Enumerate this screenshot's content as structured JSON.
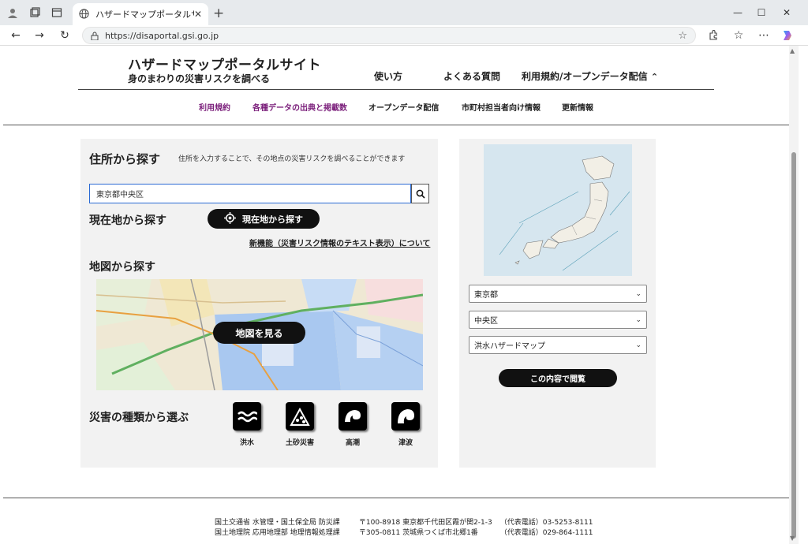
{
  "browser": {
    "tab_title": "ハザードマップポータルサイト",
    "url": "https://disaportal.gsi.go.jp"
  },
  "header": {
    "title": "ハザードマップポータルサイト",
    "subtitle": "身のまわりの災害リスクを調べる",
    "nav": [
      "使い方",
      "よくある質問",
      "利用規約/オープンデータ配信"
    ]
  },
  "subnav": [
    "利用規約",
    "各種データの出典と掲載数",
    "オープンデータ配信",
    "市町村担当者向け情報",
    "更新情報"
  ],
  "search": {
    "title": "住所から探す",
    "description": "住所を入力することで、その地点の災害リスクを調べることができます",
    "value": "東京都中央区"
  },
  "location": {
    "title": "現在地から探す",
    "button": "現在地から探す",
    "link": "新機能（災害リスク情報のテキスト表示）について"
  },
  "map_section": {
    "title": "地図から探す",
    "button": "地図を見る"
  },
  "hazard_section": {
    "title": "災害の種類から選ぶ",
    "types": [
      "洪水",
      "土砂災害",
      "高潮",
      "津波"
    ]
  },
  "selector": {
    "prefecture": "東京都",
    "city": "中央区",
    "map_type": "洪水ハザードマップ",
    "submit": "この内容で閲覧"
  },
  "footer": {
    "rows": [
      [
        "国土交通省 水管理・国土保全局 防災課",
        "〒100-8918 東京都千代田区霞が関2-1-3",
        "（代表電話）03-5253-8111"
      ],
      [
        "国土地理院 応用地理部 地理情報処理課",
        "〒305-0811 茨城県つくば市北郷1番",
        "（代表電話）029-864-1111"
      ]
    ]
  }
}
